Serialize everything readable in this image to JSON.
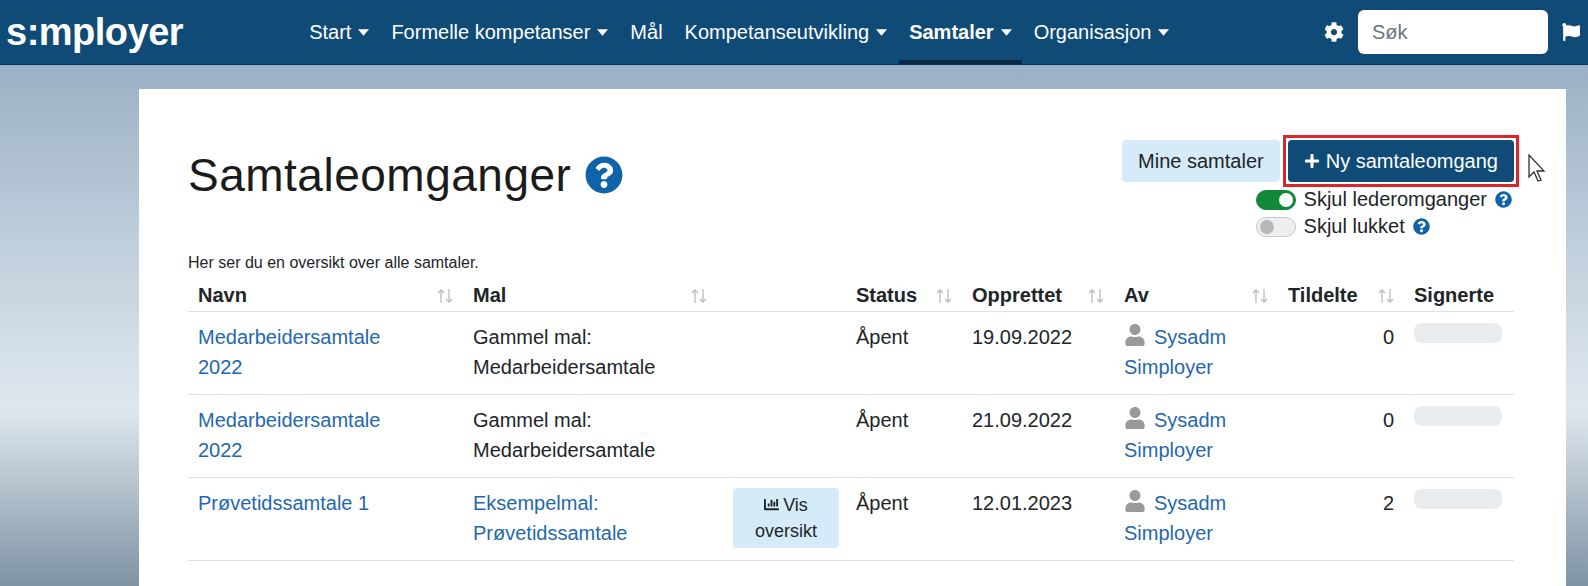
{
  "logo": "s:mployer",
  "nav": [
    {
      "label": "Start",
      "dropdown": true,
      "selected": false
    },
    {
      "label": "Formelle kompetanser",
      "dropdown": true,
      "selected": false
    },
    {
      "label": "Mål",
      "dropdown": false,
      "selected": false
    },
    {
      "label": "Kompetanseutvikling",
      "dropdown": true,
      "selected": false
    },
    {
      "label": "Samtaler",
      "dropdown": true,
      "selected": true
    },
    {
      "label": "Organisasjon",
      "dropdown": true,
      "selected": false
    }
  ],
  "search": {
    "placeholder": "Søk"
  },
  "page": {
    "title": "Samtaleomganger",
    "description": "Her ser du en oversikt over alle samtaler."
  },
  "buttons": [
    {
      "label": "Mine samtaler",
      "kind": "secondary",
      "highlighted": false
    },
    {
      "label": "Ny samtaleomgang",
      "kind": "primary",
      "highlighted": true
    }
  ],
  "toggles": [
    {
      "label": "Skjul lederomganger",
      "on": true
    },
    {
      "label": "Skjul lukket",
      "on": false
    }
  ],
  "table": {
    "columns": [
      {
        "label": "Navn",
        "sortable": true
      },
      {
        "label": "Mal",
        "sortable": true
      },
      {
        "label": "Status",
        "sortable": true
      },
      {
        "label": "Opprettet",
        "sortable": true
      },
      {
        "label": "Av",
        "sortable": true
      },
      {
        "label": "Tildelte",
        "sortable": true
      },
      {
        "label": "Signerte",
        "sortable": false
      }
    ],
    "rows": [
      {
        "name": "Medarbeidersamtale 2022",
        "template": "Gammel mal: Medarbeidersamtale",
        "overview": null,
        "status": "Åpent",
        "created": "19.09.2022",
        "author": "Sysadm Simployer",
        "assigned": "0",
        "signed_level": 0
      },
      {
        "name": "Medarbeidersamtale 2022",
        "template": "Gammel mal: Medarbeidersamtale",
        "overview": null,
        "status": "Åpent",
        "created": "21.09.2022",
        "author": "Sysadm Simployer",
        "assigned": "0",
        "signed_level": 0
      },
      {
        "name": "Prøvetidssamtale 1",
        "template": "Eksempelmal: Prøvetidssamtale",
        "overview": "Vis oversikt",
        "status": "Åpent",
        "created": "12.01.2023",
        "author": "Sysadm Simployer",
        "assigned": "2",
        "signed_level": 0
      }
    ]
  }
}
